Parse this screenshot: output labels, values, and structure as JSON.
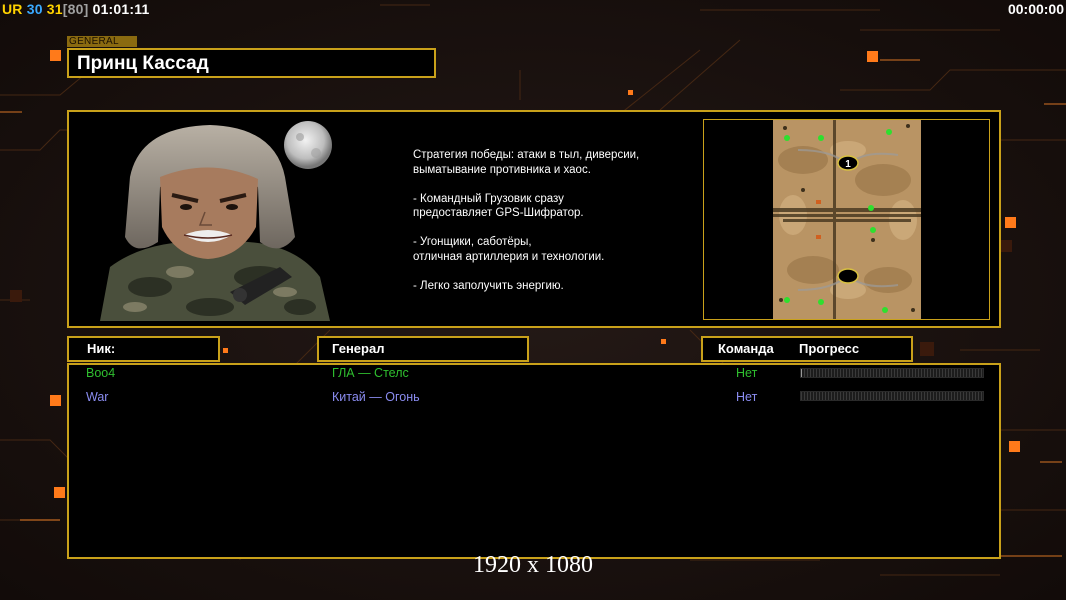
{
  "hud": {
    "tag": "UR",
    "value_a": "30",
    "value_b": "31",
    "bracket": "[80]",
    "clock": "01:01:11",
    "timer": "00:00:00",
    "colors": {
      "tag": "#ffd200",
      "value_a": "#3aa9ff",
      "value_b": "#ffd200",
      "bracket": "#a0a0a0",
      "clock": "#ffffff"
    }
  },
  "general": {
    "tag": "GENERAL",
    "name": "Принц Кассад"
  },
  "info": {
    "portrait_icon": "general-portrait",
    "strategy": [
      "Стратегия победы: атаки в тыл, диверсии,\n выматывание противника и хаос.",
      "- Командный Грузовик сразу\nпредоставляет GPS-Шифратор.",
      "- Угонщики, саботёры,\nотличная артиллерия и технологии.",
      "- Легко заполучить энергию."
    ],
    "map": {
      "icon": "minimap",
      "markers": [
        "1"
      ]
    }
  },
  "columns": {
    "nick": "Ник:",
    "general": "Генерал",
    "team": "Команда",
    "progress": "Прогресс"
  },
  "players": [
    {
      "nick": "Boo4",
      "general": "ГЛА — Стелс",
      "team": "Нет",
      "progress": 0.005,
      "color": "#2fbf2f"
    },
    {
      "nick": "War",
      "general": "Китай — Огонь",
      "team": "Нет",
      "progress": 0,
      "color": "#8a8cf0"
    }
  ],
  "footer": {
    "resolution": "1920 x 1080"
  },
  "theme": {
    "accent": "#c9a11a",
    "background": "#1a1210",
    "glow": "#ff7a1a"
  }
}
